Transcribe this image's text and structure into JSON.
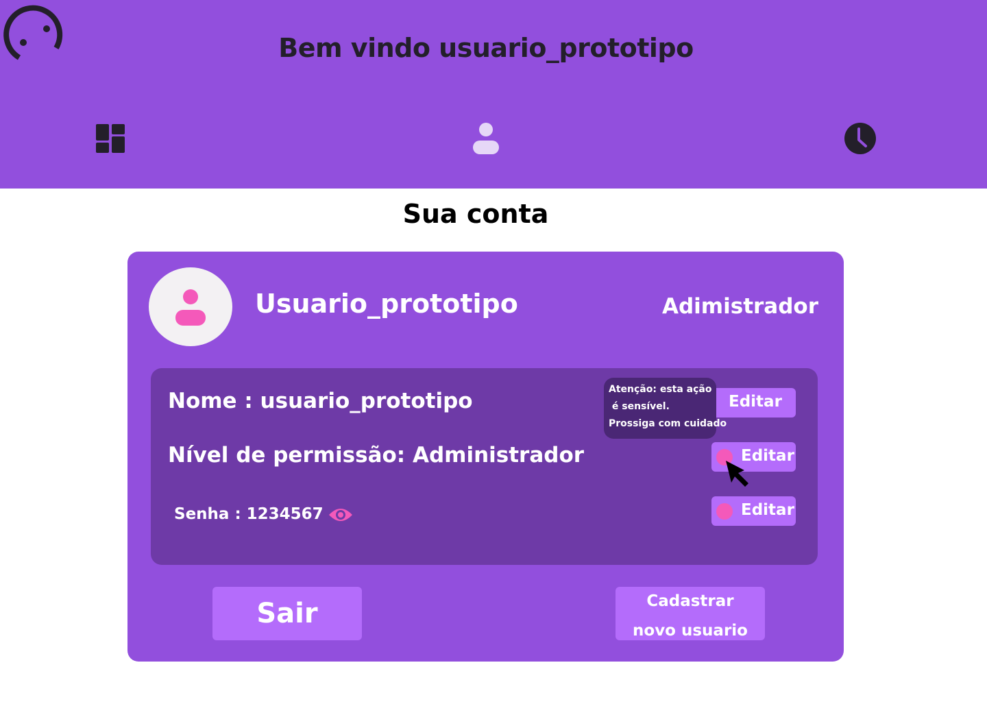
{
  "header": {
    "logo_icon": "smiley-logo-icon",
    "welcome_text": "Bem vindo usuario_prototipo",
    "background_color": "#924FDD"
  },
  "nav": {
    "items": [
      {
        "icon": "dashboard-icon",
        "active": false
      },
      {
        "icon": "user-icon",
        "active": true
      },
      {
        "icon": "clock-icon",
        "active": false
      }
    ]
  },
  "page_title": "Sua conta",
  "account_card": {
    "avatar_icon": "user-icon",
    "username": "Usuario_prototipo",
    "role": "Adimistrador",
    "details": {
      "name": "Nome : usuario_prototipo",
      "permission": "Nível de permissão: Administrador",
      "password": "Senha : 1234567",
      "password_toggle_icon": "eye-icon"
    },
    "edit_buttons": [
      {
        "label": "Editar",
        "warning": false
      },
      {
        "label": "Editar",
        "warning": true
      },
      {
        "label": "Editar",
        "warning": true
      }
    ],
    "tooltip": {
      "line1": "Atenção: esta ação",
      "line2": " é sensível.",
      "line3": "Prossiga com cuidado"
    }
  },
  "actions": {
    "exit_label": "Sair",
    "register_line1": "Cadastrar",
    "register_line2": "novo usuario"
  },
  "colors": {
    "primary": "#924FDD",
    "panel": "#6E3AA7",
    "button": "#B46CFB",
    "accent_pink": "#F459BA",
    "tooltip": "#4A2775",
    "dark": "#231F2A"
  }
}
